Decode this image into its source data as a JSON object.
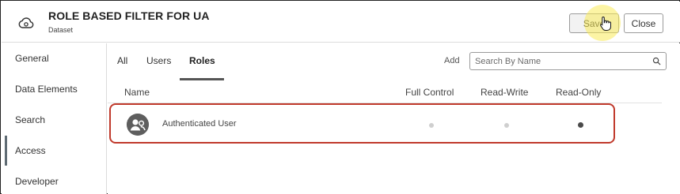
{
  "header": {
    "title": "ROLE BASED FILTER FOR UA",
    "subtitle": "Dataset",
    "save_label": "Save",
    "close_label": "Close",
    "icon": "dataset-cloud-icon"
  },
  "sidebar": {
    "items": [
      {
        "label": "General",
        "active": false
      },
      {
        "label": "Data Elements",
        "active": false
      },
      {
        "label": "Search",
        "active": false
      },
      {
        "label": "Access",
        "active": true
      },
      {
        "label": "Developer",
        "active": false
      }
    ]
  },
  "tabs": {
    "items": [
      {
        "label": "All",
        "active": false
      },
      {
        "label": "Users",
        "active": false
      },
      {
        "label": "Roles",
        "active": true
      }
    ]
  },
  "toolbar": {
    "add_label": "Add",
    "search_placeholder": "Search By Name",
    "search_value": ""
  },
  "table": {
    "columns": [
      "Name",
      "Full Control",
      "Read-Write",
      "Read-Only"
    ],
    "rows": [
      {
        "name": "Authenticated User",
        "access": "Read-Only",
        "avatar_icon": "group-avatar-icon"
      }
    ]
  },
  "colors": {
    "highlight_border": "#c0392b",
    "cursor_highlight": "#faeb5a",
    "active_indicator": "#5f6b73"
  }
}
